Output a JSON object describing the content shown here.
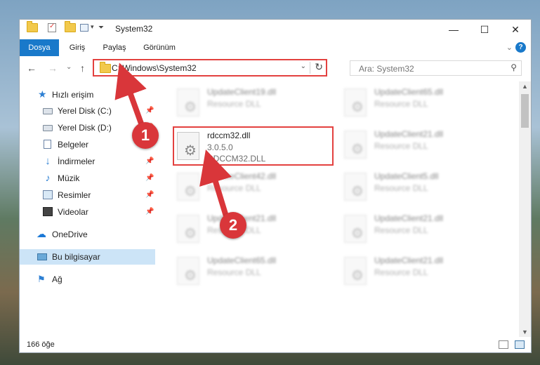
{
  "window": {
    "title": "System32",
    "caption": {
      "minimize": "—",
      "maximize": "☐",
      "close": "✕"
    },
    "ribbon_expand": "⌄",
    "help": "?"
  },
  "ribbon": {
    "tabs": [
      "Dosya",
      "Giriş",
      "Paylaş",
      "Görünüm"
    ]
  },
  "nav": {
    "back": "←",
    "forward": "→",
    "recent": "⌄",
    "up": "↑"
  },
  "address": {
    "path": "C:\\Windows\\System32",
    "dropdown": "⌄",
    "refresh": "↻"
  },
  "search": {
    "placeholder": "Ara: System32",
    "icon": "⚲"
  },
  "sidebar": {
    "items": [
      {
        "label": "Hızlı erişim",
        "icon": "star-icon",
        "pinned": false
      },
      {
        "label": "Yerel Disk (C:)",
        "icon": "drive-icon",
        "pinned": true
      },
      {
        "label": "Yerel Disk (D:)",
        "icon": "drive-icon",
        "pinned": true
      },
      {
        "label": "Belgeler",
        "icon": "document-icon",
        "pinned": true
      },
      {
        "label": "İndirmeler",
        "icon": "download-icon",
        "pinned": true
      },
      {
        "label": "Müzik",
        "icon": "music-icon",
        "pinned": true
      },
      {
        "label": "Resimler",
        "icon": "pictures-icon",
        "pinned": true
      },
      {
        "label": "Videolar",
        "icon": "video-icon",
        "pinned": true
      },
      {
        "label": "OneDrive",
        "icon": "cloud-icon",
        "pinned": false
      },
      {
        "label": "Bu bilgisayar",
        "icon": "computer-icon",
        "pinned": false,
        "selected": true
      },
      {
        "label": "Ağ",
        "icon": "network-icon",
        "pinned": false
      }
    ],
    "pin_glyph": "📌"
  },
  "files": [
    {
      "name": "UpdateClient19.dll",
      "line2": "Resource DLL",
      "line3": "",
      "blurred": true
    },
    {
      "name": "UpdateClient65.dll",
      "line2": "Resource DLL",
      "line3": "",
      "blurred": true
    },
    {
      "name": "rdccm32.dll",
      "line2": "3.0.5.0",
      "line3": "RDCCM32.DLL",
      "blurred": false,
      "highlighted": true
    },
    {
      "name": "UpdateClient21.dll",
      "line2": "Resource DLL",
      "line3": "",
      "blurred": true
    },
    {
      "name": "UpdateClient42.dll",
      "line2": "Resource DLL",
      "line3": "",
      "blurred": true
    },
    {
      "name": "UpdateClient5.dll",
      "line2": "Resource DLL",
      "line3": "",
      "blurred": true
    },
    {
      "name": "UpdateClient21.dll",
      "line2": "Resource DLL",
      "line3": "",
      "blurred": true
    },
    {
      "name": "UpdateClient21.dll",
      "line2": "Resource DLL",
      "line3": "",
      "blurred": true
    },
    {
      "name": "UpdateClient65.dll",
      "line2": "Resource DLL",
      "line3": "",
      "blurred": true
    },
    {
      "name": "UpdateClient21.dll",
      "line2": "Resource DLL",
      "line3": "",
      "blurred": true
    }
  ],
  "file_icon_glyph": "⚙",
  "status": {
    "count": "166 öğe"
  },
  "scroll": {
    "up": "▲",
    "down": "▼"
  },
  "annotations": {
    "marker1": "1",
    "marker2": "2",
    "color": "#d9363a"
  },
  "colors": {
    "accent": "#1979ca",
    "highlight": "#e3413f",
    "selected_bg": "#cce4f7"
  }
}
